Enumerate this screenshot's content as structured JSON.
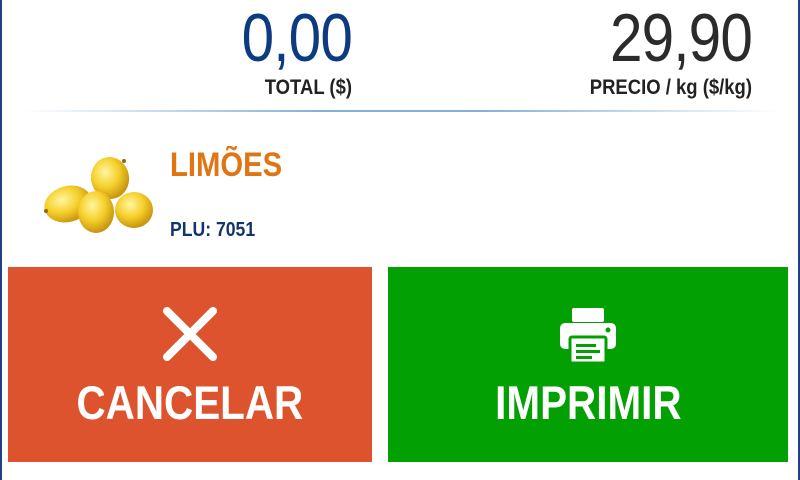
{
  "readouts": {
    "total": {
      "value": "0,00",
      "label": "TOTAL ($)"
    },
    "price": {
      "value": "29,90",
      "label": "PRECIO / kg ($/kg)"
    }
  },
  "product": {
    "name": "LIMÕES",
    "plu": "PLU: 7051",
    "image_icon": "lemons-icon"
  },
  "actions": {
    "cancel": {
      "label": "CANCELAR",
      "icon": "close-icon"
    },
    "print": {
      "label": "IMPRIMIR",
      "icon": "printer-icon"
    }
  },
  "colors": {
    "total_value": "#0d3b82",
    "product_name": "#e07514",
    "plu": "#12346e",
    "cancel_bg": "#dc532d",
    "print_bg": "#03a003"
  }
}
